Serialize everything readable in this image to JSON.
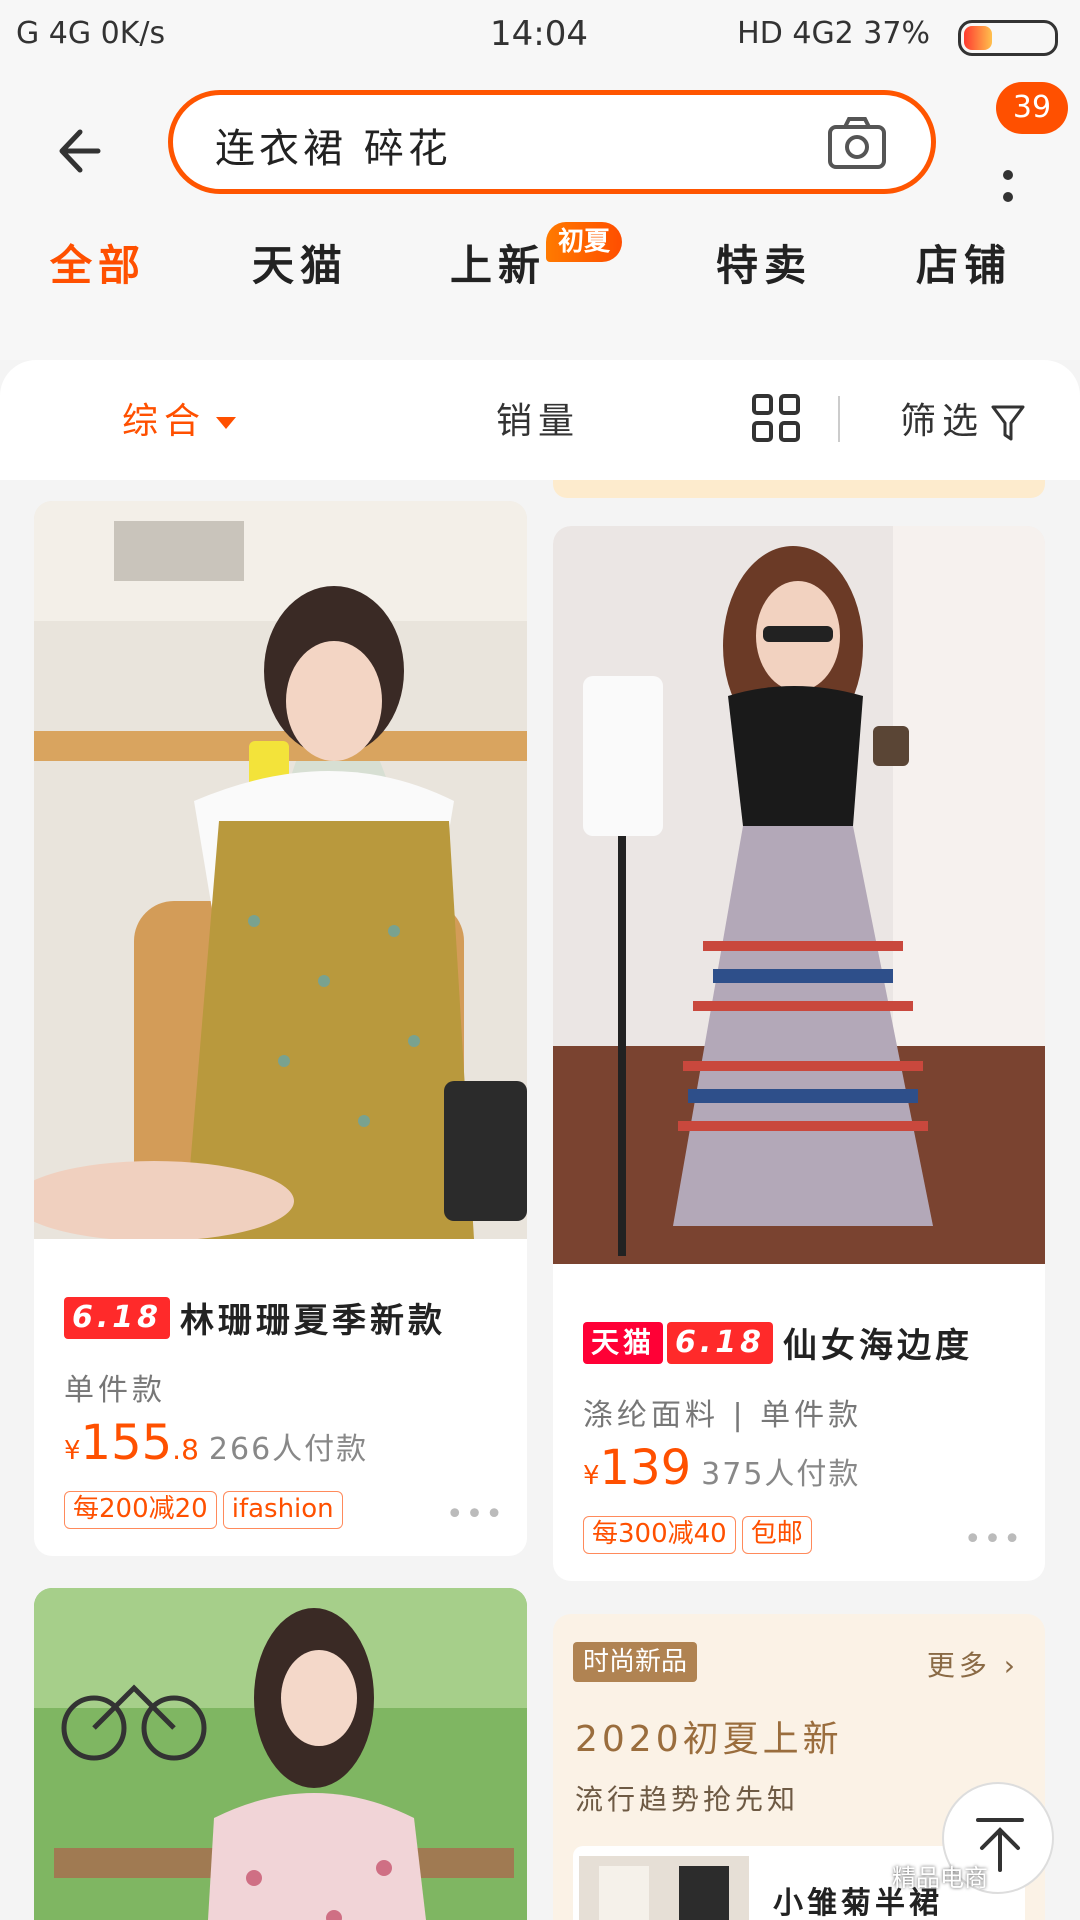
{
  "status_bar": {
    "left": "G 4G 0K/s",
    "time": "14:04",
    "right": "HD 4G2 37%"
  },
  "search": {
    "query": "连衣裙 碎花",
    "cart_badge": "39"
  },
  "tabs": [
    {
      "label": "全部",
      "active": true
    },
    {
      "label": "天猫"
    },
    {
      "label": "上新",
      "badge": "初夏"
    },
    {
      "label": "特卖"
    },
    {
      "label": "店铺"
    }
  ],
  "filters": {
    "sort": "综合",
    "sales": "销量",
    "filter": "筛选"
  },
  "products": [
    {
      "badge": "6.18",
      "title": "林珊珊夏季新款",
      "subtitle": "单件款",
      "currency": "¥",
      "price_int": "155",
      "price_dec": ".8",
      "paid": "266人付款",
      "tags": [
        "每200减20",
        "ifashion"
      ]
    },
    {
      "store_badge": "天猫",
      "badge": "6.18",
      "title": "仙女海边度",
      "subtitle": "涤纶面料 | 单件款",
      "currency": "¥",
      "price_int": "139",
      "paid": "375人付款",
      "tags": [
        "每300减40",
        "包邮"
      ]
    }
  ],
  "banner": {
    "label": "时尚新品",
    "more": "更多",
    "headline": "2020初夏上新",
    "tagline": "流行趋势抢先知",
    "item_name": "小雏菊半裙"
  },
  "watermark": "精品电商",
  "colors": {
    "accent": "#ff5000",
    "tmall": "#ff0036"
  }
}
